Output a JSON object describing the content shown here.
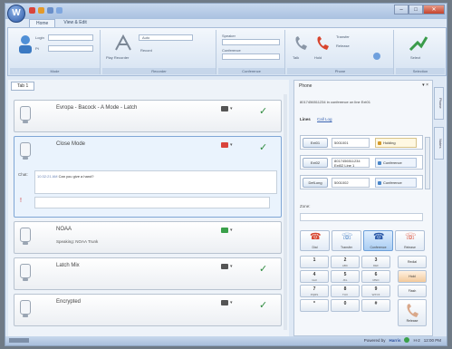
{
  "window": {
    "app_orb": "W",
    "title": "",
    "controls": {
      "minimize": "–",
      "maximize": "□",
      "close": "✕"
    },
    "qat_colors": [
      "#d9443b",
      "#e49a2a",
      "#6a8fc9",
      "#7fa7df"
    ]
  },
  "ribbon": {
    "tabs": [
      {
        "label": "Home",
        "active": true
      },
      {
        "label": "View & Edit",
        "active": false
      }
    ],
    "groups": [
      {
        "label": "Mode",
        "icon": "user-status-icon",
        "mini": [
          "Login",
          "Pt"
        ]
      },
      {
        "label": "Recorder",
        "icon": "recorder-icon",
        "mini": [
          "Play Recorder",
          "Auto",
          "Record"
        ]
      },
      {
        "label": "Conference",
        "icon": "conference-icon",
        "mini": [
          "Speaker",
          "Conference",
          "Ext"
        ]
      },
      {
        "label": "Phone",
        "icon": "phone-icon",
        "mini": [
          "Talk",
          "Hold",
          "Transfer",
          "Release"
        ]
      },
      {
        "label": "Selection",
        "icon": "selection-icon",
        "mini": [
          "Select"
        ]
      }
    ]
  },
  "leftpane": {
    "tab_label": "Tab 1",
    "calls": [
      {
        "title": "Evropa - Bacock - A Mode - Latch",
        "sub": "",
        "active": false
      },
      {
        "title": "Close Mode",
        "sub": "",
        "active": true,
        "chat": {
          "label": "Chat:",
          "time": "10:32:21 AM",
          "message": "Can you give a hand?"
        }
      },
      {
        "title": "NOAA",
        "sub": "Speaking: NOAA Trunk",
        "active": false
      },
      {
        "title": "Latch Mix",
        "sub": "",
        "active": false
      },
      {
        "title": "Encrypted",
        "sub": "",
        "active": false
      }
    ]
  },
  "rightpane": {
    "title": "Phone",
    "ctrl": "▾ ×",
    "status": "8017456511234 in conference on line Ext01",
    "tabs": {
      "active": "Lines",
      "link": "Call Log"
    },
    "lines": [
      {
        "label": "Ext01",
        "number": "5001001",
        "state": "Holding",
        "kind": "hold"
      },
      {
        "label": "Ext02",
        "number": "8017456511234",
        "number2": "Ext02 Line 1",
        "state": "Conference",
        "kind": "conf"
      },
      {
        "label": "DefLong",
        "number": "5001002",
        "state": "Conference",
        "kind": "conf"
      }
    ],
    "zone_label": "Zone:",
    "call_buttons": [
      {
        "label": "Dial",
        "glyph": "☎",
        "on": false
      },
      {
        "label": "Transfer",
        "glyph": "☏",
        "on": false
      },
      {
        "label": "Conference",
        "glyph": "☎",
        "on": true
      },
      {
        "label": "Release",
        "glyph": "☏",
        "on": false
      }
    ],
    "keypad": [
      {
        "d": "1",
        "l": ""
      },
      {
        "d": "2",
        "l": "ABC"
      },
      {
        "d": "3",
        "l": "DEF"
      },
      {
        "d": "4",
        "l": "GHI"
      },
      {
        "d": "5",
        "l": "JKL"
      },
      {
        "d": "6",
        "l": "MNO"
      },
      {
        "d": "7",
        "l": "PQRS"
      },
      {
        "d": "8",
        "l": "TUV"
      },
      {
        "d": "9",
        "l": "WXYZ"
      },
      {
        "d": "*",
        "l": ""
      },
      {
        "d": "0",
        "l": ""
      },
      {
        "d": "#",
        "l": ""
      }
    ],
    "side_keys": [
      "Redial",
      "Hold",
      "Flash"
    ],
    "big_phone_label": "Release"
  },
  "vtabs": [
    "Phone",
    "Notes"
  ],
  "statusbar": {
    "powered": "Powered by",
    "logo": "Harris",
    "code": "H-2",
    "time": "12:00 PM"
  }
}
